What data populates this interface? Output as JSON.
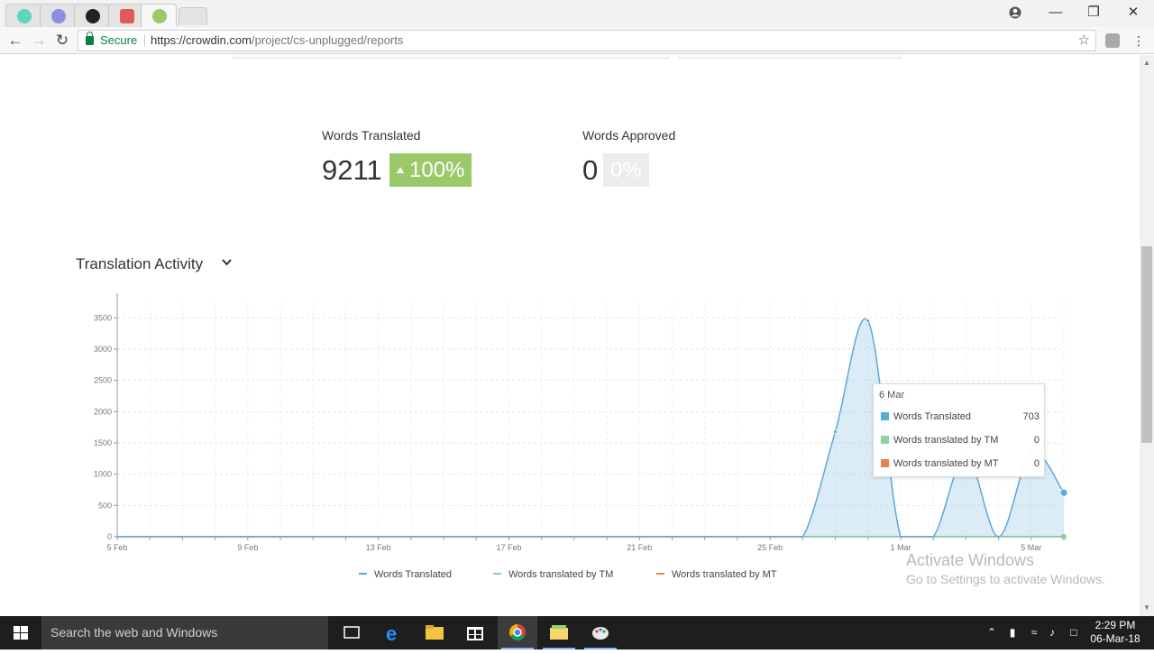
{
  "browser": {
    "secure_label": "Secure",
    "url_host": "https://crowdin.com",
    "url_path": "/project/cs-unplugged/reports"
  },
  "stats": {
    "translated_label": "Words Translated",
    "translated_value": "9211",
    "translated_badge": "100%",
    "approved_label": "Words Approved",
    "approved_value": "0",
    "approved_badge": "0%"
  },
  "section": {
    "title": "Translation Activity"
  },
  "chart_data": {
    "type": "area",
    "xlabel": "",
    "ylabel": "",
    "ylim": [
      0,
      3750
    ],
    "y_ticks": [
      0,
      500,
      1000,
      1500,
      2000,
      2500,
      3000,
      3500
    ],
    "x_tick_labels": [
      "5 Feb",
      "9 Feb",
      "13 Feb",
      "17 Feb",
      "21 Feb",
      "25 Feb",
      "1 Mar",
      "5 Mar"
    ],
    "x": [
      "5 Feb",
      "6 Feb",
      "7 Feb",
      "8 Feb",
      "9 Feb",
      "10 Feb",
      "11 Feb",
      "12 Feb",
      "13 Feb",
      "14 Feb",
      "15 Feb",
      "16 Feb",
      "17 Feb",
      "18 Feb",
      "19 Feb",
      "20 Feb",
      "21 Feb",
      "22 Feb",
      "23 Feb",
      "24 Feb",
      "25 Feb",
      "26 Feb",
      "27 Feb",
      "28 Feb",
      "1 Mar",
      "2 Mar",
      "3 Mar",
      "4 Mar",
      "5 Mar",
      "6 Mar"
    ],
    "series": [
      {
        "name": "Words Translated",
        "color": "#5aa9d9",
        "values": [
          0,
          0,
          0,
          0,
          0,
          0,
          0,
          0,
          0,
          0,
          0,
          0,
          0,
          0,
          0,
          0,
          0,
          0,
          0,
          0,
          0,
          0,
          1680,
          3450,
          0,
          0,
          1300,
          0,
          1350,
          703
        ]
      },
      {
        "name": "Words translated by TM",
        "color": "#8fd3a0",
        "values": [
          0,
          0,
          0,
          0,
          0,
          0,
          0,
          0,
          0,
          0,
          0,
          0,
          0,
          0,
          0,
          0,
          0,
          0,
          0,
          0,
          0,
          0,
          0,
          0,
          0,
          0,
          0,
          0,
          0,
          0
        ]
      },
      {
        "name": "Words translated by MT",
        "color": "#e8834f",
        "values": [
          0,
          0,
          0,
          0,
          0,
          0,
          0,
          0,
          0,
          0,
          0,
          0,
          0,
          0,
          0,
          0,
          0,
          0,
          0,
          0,
          0,
          0,
          0,
          0,
          0,
          0,
          0,
          0,
          0,
          0
        ]
      }
    ],
    "grid": true,
    "legend": "bottom-center"
  },
  "tooltip": {
    "date": "6 Mar",
    "rows": [
      {
        "label": "Words Translated",
        "value": "703",
        "color": "#5aa9d9"
      },
      {
        "label": "Words translated by TM",
        "value": "0",
        "color": "#8fd3a0"
      },
      {
        "label": "Words translated by MT",
        "value": "0",
        "color": "#e8834f"
      }
    ]
  },
  "watermark": {
    "line1": "Activate Windows",
    "line2": "Go to Settings to activate Windows."
  },
  "taskbar": {
    "search_placeholder": "Search the web and Windows",
    "time": "2:29 PM",
    "date": "06-Mar-18"
  }
}
